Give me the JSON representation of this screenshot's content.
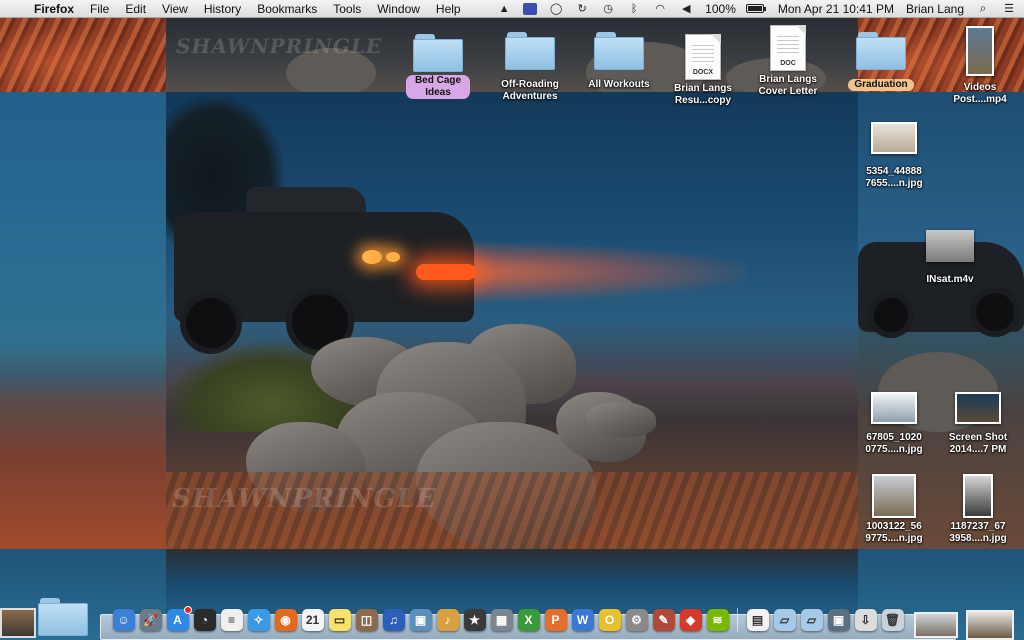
{
  "menubar": {
    "app_name": "Firefox",
    "menus": [
      "File",
      "Edit",
      "View",
      "History",
      "Bookmarks",
      "Tools",
      "Window",
      "Help"
    ],
    "battery_percent": "100%",
    "battery_level": 1.0,
    "datetime": "Mon Apr 21  10:41 PM",
    "user_name": "Brian Lang",
    "status_icons": [
      "google-drive-icon",
      "app-indicator-icon",
      "chat-bubble-icon",
      "sync-icon",
      "time-machine-icon",
      "bluetooth-icon",
      "wifi-icon",
      "volume-icon"
    ]
  },
  "desktop": {
    "top_icons": [
      {
        "type": "folder",
        "label": "Bed Cage Ideas",
        "label_color": "purple"
      },
      {
        "type": "folder",
        "label": "Off-Roading Adventures",
        "label_color": ""
      },
      {
        "type": "folder",
        "label": "All Workouts",
        "label_color": ""
      },
      {
        "type": "document",
        "ext": "DOCX",
        "label": "Brian Langs Resu...copy",
        "label_color": ""
      },
      {
        "type": "document",
        "ext": "DOC",
        "label": "Brian Langs Cover Letter",
        "label_color": ""
      },
      {
        "type": "folder",
        "label": "Graduation",
        "label_color": "orange"
      },
      {
        "type": "video",
        "label": "Videos Post....mp4",
        "label_color": ""
      }
    ],
    "side_icons": [
      {
        "type": "image",
        "label": "5354_44888 7655....n.jpg"
      },
      {
        "type": "video",
        "label": "INsat.m4v"
      },
      {
        "type": "image",
        "label": "67805_1020 0775....n.jpg"
      },
      {
        "type": "image",
        "label": "Screen Shot 2014....7 PM"
      },
      {
        "type": "image",
        "label": "1003122_56 9775....n.jpg"
      },
      {
        "type": "image",
        "label": "1187237_67 3958....n.jpg"
      }
    ],
    "wallpaper_watermark": "SHAWNPRINGLE"
  },
  "dock": {
    "apps": [
      {
        "name": "finder-icon",
        "glyph": "☺",
        "color": "#3b7fd6"
      },
      {
        "name": "launchpad-icon",
        "glyph": "🚀",
        "color": "#6a7b8c"
      },
      {
        "name": "app-store-icon",
        "glyph": "A",
        "color": "#2a8ae6"
      },
      {
        "name": "dashboard-icon",
        "glyph": "◔",
        "color": "#2b2b2b"
      },
      {
        "name": "notes-list-icon",
        "glyph": "≡",
        "color": "#efefef"
      },
      {
        "name": "safari-icon",
        "glyph": "✧",
        "color": "#3b9ae6"
      },
      {
        "name": "firefox-icon",
        "glyph": "◉",
        "color": "#e36a1c"
      },
      {
        "name": "calendar-icon",
        "glyph": "21",
        "color": "#f4f4f4"
      },
      {
        "name": "stickies-icon",
        "glyph": "▭",
        "color": "#f7e36b"
      },
      {
        "name": "photo-booth-icon",
        "glyph": "◫",
        "color": "#8c6a4c"
      },
      {
        "name": "itunes-icon",
        "glyph": "♫",
        "color": "#2b5fb8"
      },
      {
        "name": "iphoto-icon",
        "glyph": "▣",
        "color": "#5a8fbf"
      },
      {
        "name": "garageband-icon",
        "glyph": "♪",
        "color": "#d9a040"
      },
      {
        "name": "imovie-icon",
        "glyph": "★",
        "color": "#3a3a3a"
      },
      {
        "name": "screen-capture-icon",
        "glyph": "▦",
        "color": "#7d8590"
      },
      {
        "name": "excel-icon",
        "glyph": "X",
        "color": "#3a9a3a"
      },
      {
        "name": "powerpoint-icon",
        "glyph": "P",
        "color": "#e2702c"
      },
      {
        "name": "word-icon",
        "glyph": "W",
        "color": "#3a78d6"
      },
      {
        "name": "outlook-icon",
        "glyph": "O",
        "color": "#e8c02c"
      },
      {
        "name": "automator-icon",
        "glyph": "⚙",
        "color": "#8a8a8a"
      },
      {
        "name": "system-tool-icon",
        "glyph": "✎",
        "color": "#b04a3a"
      },
      {
        "name": "sketchup-icon",
        "glyph": "◆",
        "color": "#d63a2a"
      },
      {
        "name": "spotify-icon",
        "glyph": "≋",
        "color": "#7ab800"
      }
    ],
    "right_items": [
      {
        "name": "document-stack-icon",
        "glyph": "▤",
        "color": "#f2f2f2"
      },
      {
        "name": "applications-folder-icon",
        "glyph": "▱",
        "color": "#a6c9e8"
      },
      {
        "name": "documents-folder-icon",
        "glyph": "▱",
        "color": "#a6c9e8"
      },
      {
        "name": "screenshot-stack-icon",
        "glyph": "▣",
        "color": "#5c6e80"
      },
      {
        "name": "downloads-stack-icon",
        "glyph": "⇩",
        "color": "#dcdcdc"
      },
      {
        "name": "trash-icon",
        "glyph": "🗑",
        "color": "#c9d2da"
      }
    ]
  }
}
